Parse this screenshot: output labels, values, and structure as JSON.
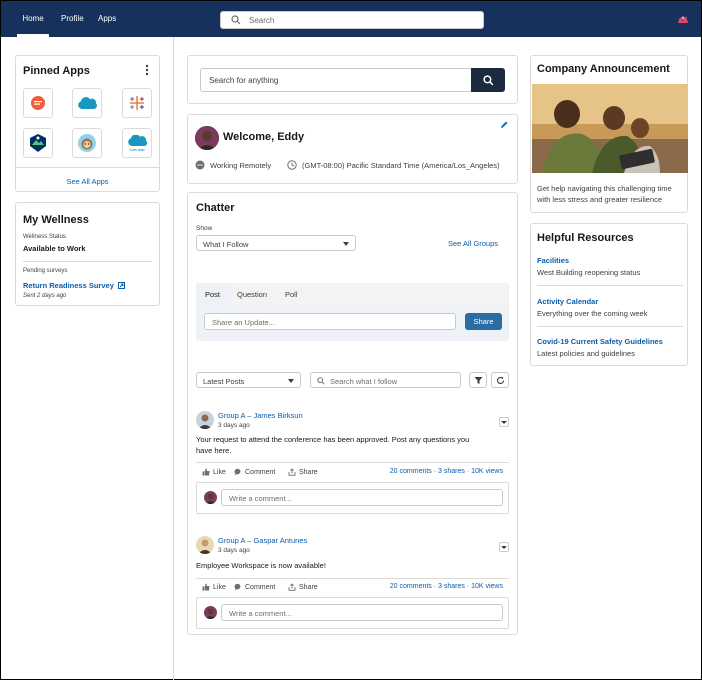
{
  "nav": {
    "home": "Home",
    "profile": "Profile",
    "apps": "Apps",
    "search_placeholder": "Search"
  },
  "pinned_apps": {
    "title": "Pinned Apps",
    "see_all": "See All Apps",
    "apps": [
      {
        "icon": "chat-bubble-app-icon"
      },
      {
        "icon": "salesforce-cloud-app-icon"
      },
      {
        "icon": "tableau-app-icon"
      },
      {
        "icon": "trailhead-badge-app-icon"
      },
      {
        "icon": "astro-character-app-icon"
      },
      {
        "icon": "cloud-app-icon",
        "label": "Cum dolo"
      }
    ]
  },
  "wellness": {
    "title": "My Wellness",
    "status_label": "Wellness Status",
    "status_value": "Available to Work",
    "pending_label": "Pending surveys",
    "survey_link": "Return Readiness Survey",
    "survey_sent": "Sent 2 days ago"
  },
  "center": {
    "search_placeholder": "Search for anything",
    "welcome": "Welcome, Eddy",
    "work_status": "Working Remotely",
    "timezone": "(GMT-08:00) Pacific Standard Time (America/Los_Angeles)"
  },
  "chatter": {
    "title": "Chatter",
    "show_label": "Show",
    "show_value": "What I Follow",
    "see_all_groups": "See All Groups",
    "tabs": [
      "Post",
      "Question",
      "Poll"
    ],
    "share_placeholder": "Share an Update...",
    "share_button": "Share",
    "sort_value": "Latest Posts",
    "search_placeholder": "Search what I follow",
    "posts": [
      {
        "author": "Group A – James Birksun",
        "time": "3 days ago",
        "body": "Your request to attend the conference has been approved. Post any questions you have here.",
        "like": "Like",
        "comment": "Comment",
        "share": "Share",
        "stats": "20 comments · 3 shares · 10K views",
        "comment_placeholder": "Write a comment..."
      },
      {
        "author": "Group A – Gaspar Antunes",
        "time": "3 days ago",
        "body": "Employee Workspace is now available!",
        "like": "Like",
        "comment": "Comment",
        "share": "Share",
        "stats": "20 comments · 3 shares · 10K views",
        "comment_placeholder": "Write a comment..."
      }
    ]
  },
  "announcement": {
    "title": "Company Announcement",
    "text": "Get help navigating this challenging time with less stress and greater resilience"
  },
  "resources": {
    "title": "Helpful Resources",
    "items": [
      {
        "title": "Facilities",
        "desc": "West Building reopening status"
      },
      {
        "title": "Activity Calendar",
        "desc": "Everything over the coming week"
      },
      {
        "title": "Covid-19 Current Safety Guidelines",
        "desc": "Latest policies and guidelines"
      }
    ]
  },
  "colors": {
    "nav_bg": "#16325c",
    "link": "#0b5cab",
    "brand_button": "#0176d3",
    "dark_button": "#1b2a40"
  }
}
